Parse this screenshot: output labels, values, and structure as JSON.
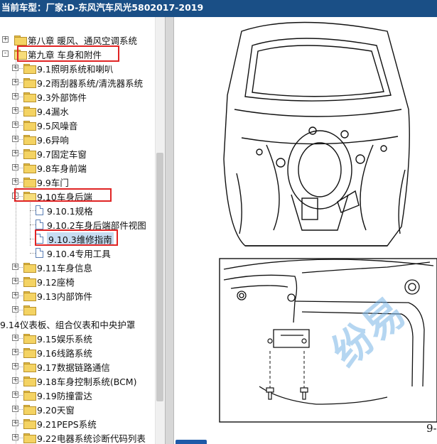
{
  "titlebar": {
    "text": "当前车型：厂家:D-东风汽车风光5802017-2019"
  },
  "tree": {
    "items": [
      {
        "label": "第八章 暖风、通风空调系统",
        "level": 1,
        "expander": "+",
        "icon": "folder-icon"
      },
      {
        "label": "第九章 车身和附件",
        "level": 1,
        "expander": "-",
        "icon": "folder-open-icon"
      },
      {
        "label": "9.1照明系统和喇叭",
        "level": 2,
        "expander": "+",
        "icon": "folder-icon"
      },
      {
        "label": "9.2雨刮器系统/清洗器系统",
        "level": 2,
        "expander": "+",
        "icon": "folder-icon"
      },
      {
        "label": "9.3外部饰件",
        "level": 2,
        "expander": "+",
        "icon": "folder-icon"
      },
      {
        "label": "9.4漏水",
        "level": 2,
        "expander": "+",
        "icon": "folder-icon"
      },
      {
        "label": "9.5风噪音",
        "level": 2,
        "expander": "+",
        "icon": "folder-icon"
      },
      {
        "label": "9.6异响",
        "level": 2,
        "expander": "+",
        "icon": "folder-icon"
      },
      {
        "label": "9.7固定车窗",
        "level": 2,
        "expander": "+",
        "icon": "folder-icon"
      },
      {
        "label": "9.8车身前端",
        "level": 2,
        "expander": "+",
        "icon": "folder-icon"
      },
      {
        "label": "9.9车门",
        "level": 2,
        "expander": "+",
        "icon": "folder-icon"
      },
      {
        "label": "9.10车身后端",
        "level": 2,
        "expander": "-",
        "icon": "folder-open-icon"
      },
      {
        "label": "9.10.1规格",
        "level": 3,
        "icon": "page-icon"
      },
      {
        "label": "9.10.2车身后端部件视图",
        "level": 3,
        "icon": "page-icon"
      },
      {
        "label": "9.10.3维修指南",
        "level": 3,
        "icon": "page-icon",
        "selected": true
      },
      {
        "label": "9.10.4专用工具",
        "level": 3,
        "icon": "page-icon"
      },
      {
        "label": "9.11车身信息",
        "level": 2,
        "expander": "+",
        "icon": "folder-icon"
      },
      {
        "label": "9.12座椅",
        "level": 2,
        "expander": "+",
        "icon": "folder-icon"
      },
      {
        "label": "9.13内部饰件",
        "level": 2,
        "expander": "+",
        "icon": "folder-icon"
      },
      {
        "label": "",
        "level": 2,
        "expander": "+",
        "icon": "folder-icon"
      },
      {
        "label": "9.14仪表板、组合仪表和中央护罩",
        "level": 0
      },
      {
        "label": "9.15娱乐系统",
        "level": 2,
        "expander": "+",
        "icon": "folder-icon"
      },
      {
        "label": "9.16线路系统",
        "level": 2,
        "expander": "+",
        "icon": "folder-icon"
      },
      {
        "label": "9.17数据链路通信",
        "level": 2,
        "expander": "+",
        "icon": "folder-icon"
      },
      {
        "label": "9.18车身控制系统(BCM)",
        "level": 2,
        "expander": "+",
        "icon": "folder-icon"
      },
      {
        "label": "9.19防撞雷达",
        "level": 2,
        "expander": "+",
        "icon": "folder-icon"
      },
      {
        "label": "9.20天窗",
        "level": 2,
        "expander": "+",
        "icon": "folder-icon"
      },
      {
        "label": "9.21PEPS系统",
        "level": 2,
        "expander": "+",
        "icon": "folder-icon"
      },
      {
        "label": "9.22电器系统诊断代码列表",
        "level": 2,
        "expander": "+",
        "icon": "folder-icon"
      }
    ]
  },
  "document": {
    "page_number": "9-",
    "watermark": "纷易"
  },
  "colors": {
    "titlebar": "#1a4f86",
    "highlight_box": "#e02424",
    "selection": "#c7ddf2"
  }
}
